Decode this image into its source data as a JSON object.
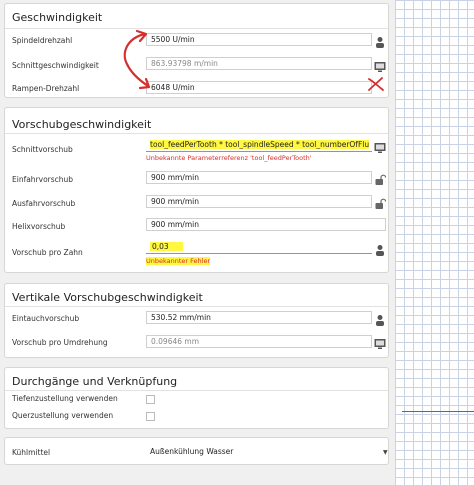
{
  "speed": {
    "title": "Geschwindigkeit",
    "spindle_label": "Spindeldrehzahl",
    "spindle_value": "5500 U/min",
    "cutting_label": "Schnittgeschwindigkeit",
    "cutting_value": "863.93798 m/min",
    "ramp_label": "Rampen-Drehzahl",
    "ramp_value": "6048 U/min"
  },
  "feed": {
    "title": "Vorschubgeschwindigkeit",
    "cutting_label": "Schnittvorschub",
    "cutting_value": "tool_feedPerTooth * tool_spindleSpeed * tool_numberOfFlu",
    "cutting_error": "Unbekannte Parameterreferenz 'tool_feedPerTooth'",
    "entry_label": "Einfahrvorschub",
    "entry_value": "900 mm/min",
    "exit_label": "Ausfahrvorschub",
    "exit_value": "900 mm/min",
    "helix_label": "Helixvorschub",
    "helix_value": "900 mm/min",
    "per_tooth_label": "Vorschub pro Zahn",
    "per_tooth_value": "0,03",
    "per_tooth_error": "Unbekannter Fehler"
  },
  "vertical": {
    "title": "Vertikale Vorschubgeschwindigkeit",
    "plunge_label": "Eintauchvorschub",
    "plunge_value": "530.52 mm/min",
    "per_rev_label": "Vorschub pro Umdrehung",
    "per_rev_value": "0.09646 mm"
  },
  "passes": {
    "title": "Durchgänge und Verknüpfung",
    "depth_label": "Tiefenzustellung verwenden",
    "lateral_label": "Querzustellung verwenden"
  },
  "coolant": {
    "label": "Kühlmittel",
    "value": "Außenkühlung Wasser"
  },
  "colors": {
    "highlight": "#fff740",
    "error": "#d32f2f",
    "annotation": "#d32f2f"
  }
}
